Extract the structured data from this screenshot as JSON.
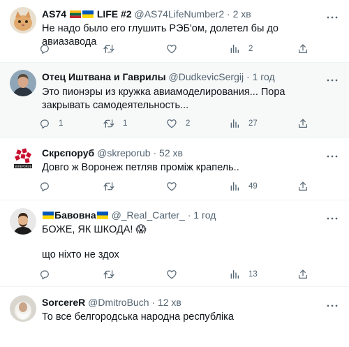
{
  "tweets": [
    {
      "name": "AS74",
      "name_suffix": "LIFE #2",
      "handle": "@AS74LifeNumber2",
      "separator": "·",
      "time": "2 хв",
      "text": "Не надо было его глушить РЭБ'ом, долетел бы до авиазавода",
      "replies": "",
      "retweets": "",
      "likes": "",
      "views": "2"
    },
    {
      "name": "Отец Иштвана и Гаврилы",
      "handle": "@DudkevicSergij",
      "separator": "·",
      "time": "1 год",
      "text": "Это пионэры из кружка авиамоделирования... Пора закрывать самодеятельность...",
      "replies": "1",
      "retweets": "1",
      "likes": "2",
      "views": "27"
    },
    {
      "name": "Скрєпоруб",
      "handle": "@skreporub",
      "separator": "·",
      "time": "52 хв",
      "text": "Довго ж Воронеж петляв проміж крапель..",
      "replies": "",
      "retweets": "",
      "likes": "",
      "views": "49"
    },
    {
      "name": "Бавовна",
      "handle": "@_Real_Carter_",
      "separator": "·",
      "time": "1 год",
      "text": "БОЖЕ, ЯК ШКОДА! 😱",
      "text2": "що ніхто не здох",
      "replies": "",
      "retweets": "",
      "likes": "",
      "views": "13"
    },
    {
      "name": "SorcereR",
      "handle": "@DmitroBuch",
      "separator": "·",
      "time": "12 хв",
      "text": "То все белгородська народна республіка"
    }
  ],
  "avatar_logo_text": "SKREPORUB",
  "icons": [
    "reply-icon",
    "retweet-icon",
    "like-icon",
    "views-icon",
    "share-icon",
    "more-icon"
  ],
  "colors": {
    "icon_gray": "#536471",
    "divider": "#eff3f4",
    "highlight_bg": "#f7f9f9",
    "ua_blue": "#0057b7",
    "ua_yellow": "#ffd700"
  }
}
